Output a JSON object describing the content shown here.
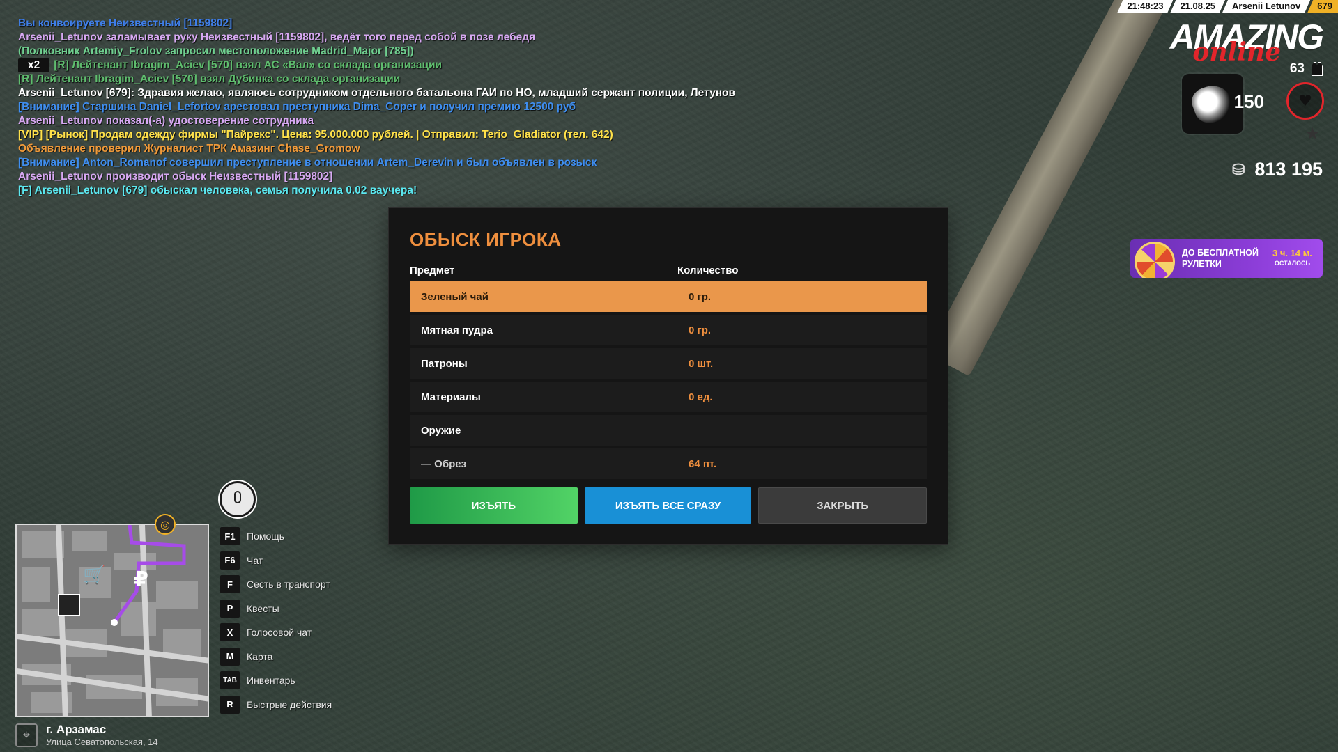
{
  "hud": {
    "time": "21:48:23",
    "date": "21.08.25",
    "player_name": "Arsenii Letunov",
    "player_id": "679",
    "logo_main": "AMAZING",
    "logo_sub": "online",
    "armor": "63",
    "health": "150",
    "money": "813 195",
    "roulette_title": "ДО БЕСПЛАТНОЙ РУЛЕТКИ",
    "roulette_time": "3 ч. 14 м.",
    "roulette_left": "ОСТАЛОСЬ",
    "colors": {
      "accent": "#ef8f3e",
      "brand_red": "#e2252b",
      "id_badge": "#f0b126"
    }
  },
  "chat": {
    "lines": [
      {
        "text": "Вы конвоируете Неизвестный [1159802]",
        "color": "#3f7ee8"
      },
      {
        "text": "Arsenii_Letunov заламывает руку Неизвестный [1159802], ведёт того перед собой в позе лебедя",
        "color": "#d7a8f2"
      },
      {
        "text": "(Полковник Artemiy_Frolov запросил местоположение Madrid_Major [785])",
        "color": "#6fcf8f"
      },
      {
        "badge": "x2",
        "text": "[R] Лейтенант Ibragim_Aciev [570] взял АС «Вал» со склада организации",
        "color": "#5fbd6e"
      },
      {
        "text": "[R] Лейтенант Ibragim_Aciev [570] взял Дубинка со склада организации",
        "color": "#5fbd6e"
      },
      {
        "text": "Arsenii_Letunov [679]: Здравия желаю, являюсь сотрудником отдельного батальона ГАИ по НО, младший сержант полиции, Летунов",
        "color": "#ffffff"
      },
      {
        "text": "[Внимание] Старшина Daniel_Lefortov арестовал преступника Dima_Coper и получил премию 12500 руб",
        "color": "#3f8ef0"
      },
      {
        "text": "Arsenii_Letunov показал(-а) удостоверение сотрудника",
        "color": "#d7a8f2"
      },
      {
        "text": "[VIP] [Рынок] Продам одежду фирмы \"Пайрекс\". Цена: 95.000.000 рублей. | Отправил: Terio_Gladiator (тел. 642)",
        "color": "#ffe14a"
      },
      {
        "text": "Объявление проверил Журналист ТРК Амазинг Chase_Gromow",
        "color": "#f09a3a"
      },
      {
        "text": "[Внимание] Anton_Romanof совершил преступление в отношении Artem_Derevin и был объявлен в розыск",
        "color": "#3f8ef0"
      },
      {
        "text": "Arsenii_Letunov производит обыск Неизвестный [1159802]",
        "color": "#d7a8f2"
      },
      {
        "text": "[F] Arsenii_Letunov [679] обыскал человека, семья получила 0.02 ваучера!",
        "color": "#5ce8f0"
      }
    ]
  },
  "dialog": {
    "title": "ОБЫСК ИГРОКА",
    "col_item": "Предмет",
    "col_qty": "Количество",
    "rows": [
      {
        "item": "Зеленый чай",
        "qty": "0 гр."
      },
      {
        "item": "Мятная пудра",
        "qty": "0 гр."
      },
      {
        "item": "Патроны",
        "qty": "0 шт."
      },
      {
        "item": "Материалы",
        "qty": "0 ед."
      },
      {
        "item": "Оружие",
        "qty": ""
      },
      {
        "item": "— Обрез",
        "qty": "64 пт."
      }
    ],
    "btn_take": "ИЗЪЯТЬ",
    "btn_take_all": "ИЗЪЯТЬ ВСЕ СРАЗУ",
    "btn_close": "ЗАКРЫТЬ"
  },
  "hotkeys": [
    {
      "key": "F1",
      "label": "Помощь"
    },
    {
      "key": "F6",
      "label": "Чат"
    },
    {
      "key": "F",
      "label": "Сесть в транспорт"
    },
    {
      "key": "P",
      "label": "Квесты"
    },
    {
      "key": "X",
      "label": "Голосовой чат"
    },
    {
      "key": "M",
      "label": "Карта"
    },
    {
      "key": "TAB",
      "label": "Инвентарь"
    },
    {
      "key": "R",
      "label": "Быстрые действия"
    }
  ],
  "location": {
    "city": "г. Арзамас",
    "street": "Улица Севатопольская, 14"
  },
  "icons": [
    "microphone-icon",
    "gps-target-icon",
    "heart-icon",
    "vest-icon",
    "coins-icon",
    "star-icon",
    "map-pin-icon",
    "ruble-icon",
    "cart-icon"
  ]
}
